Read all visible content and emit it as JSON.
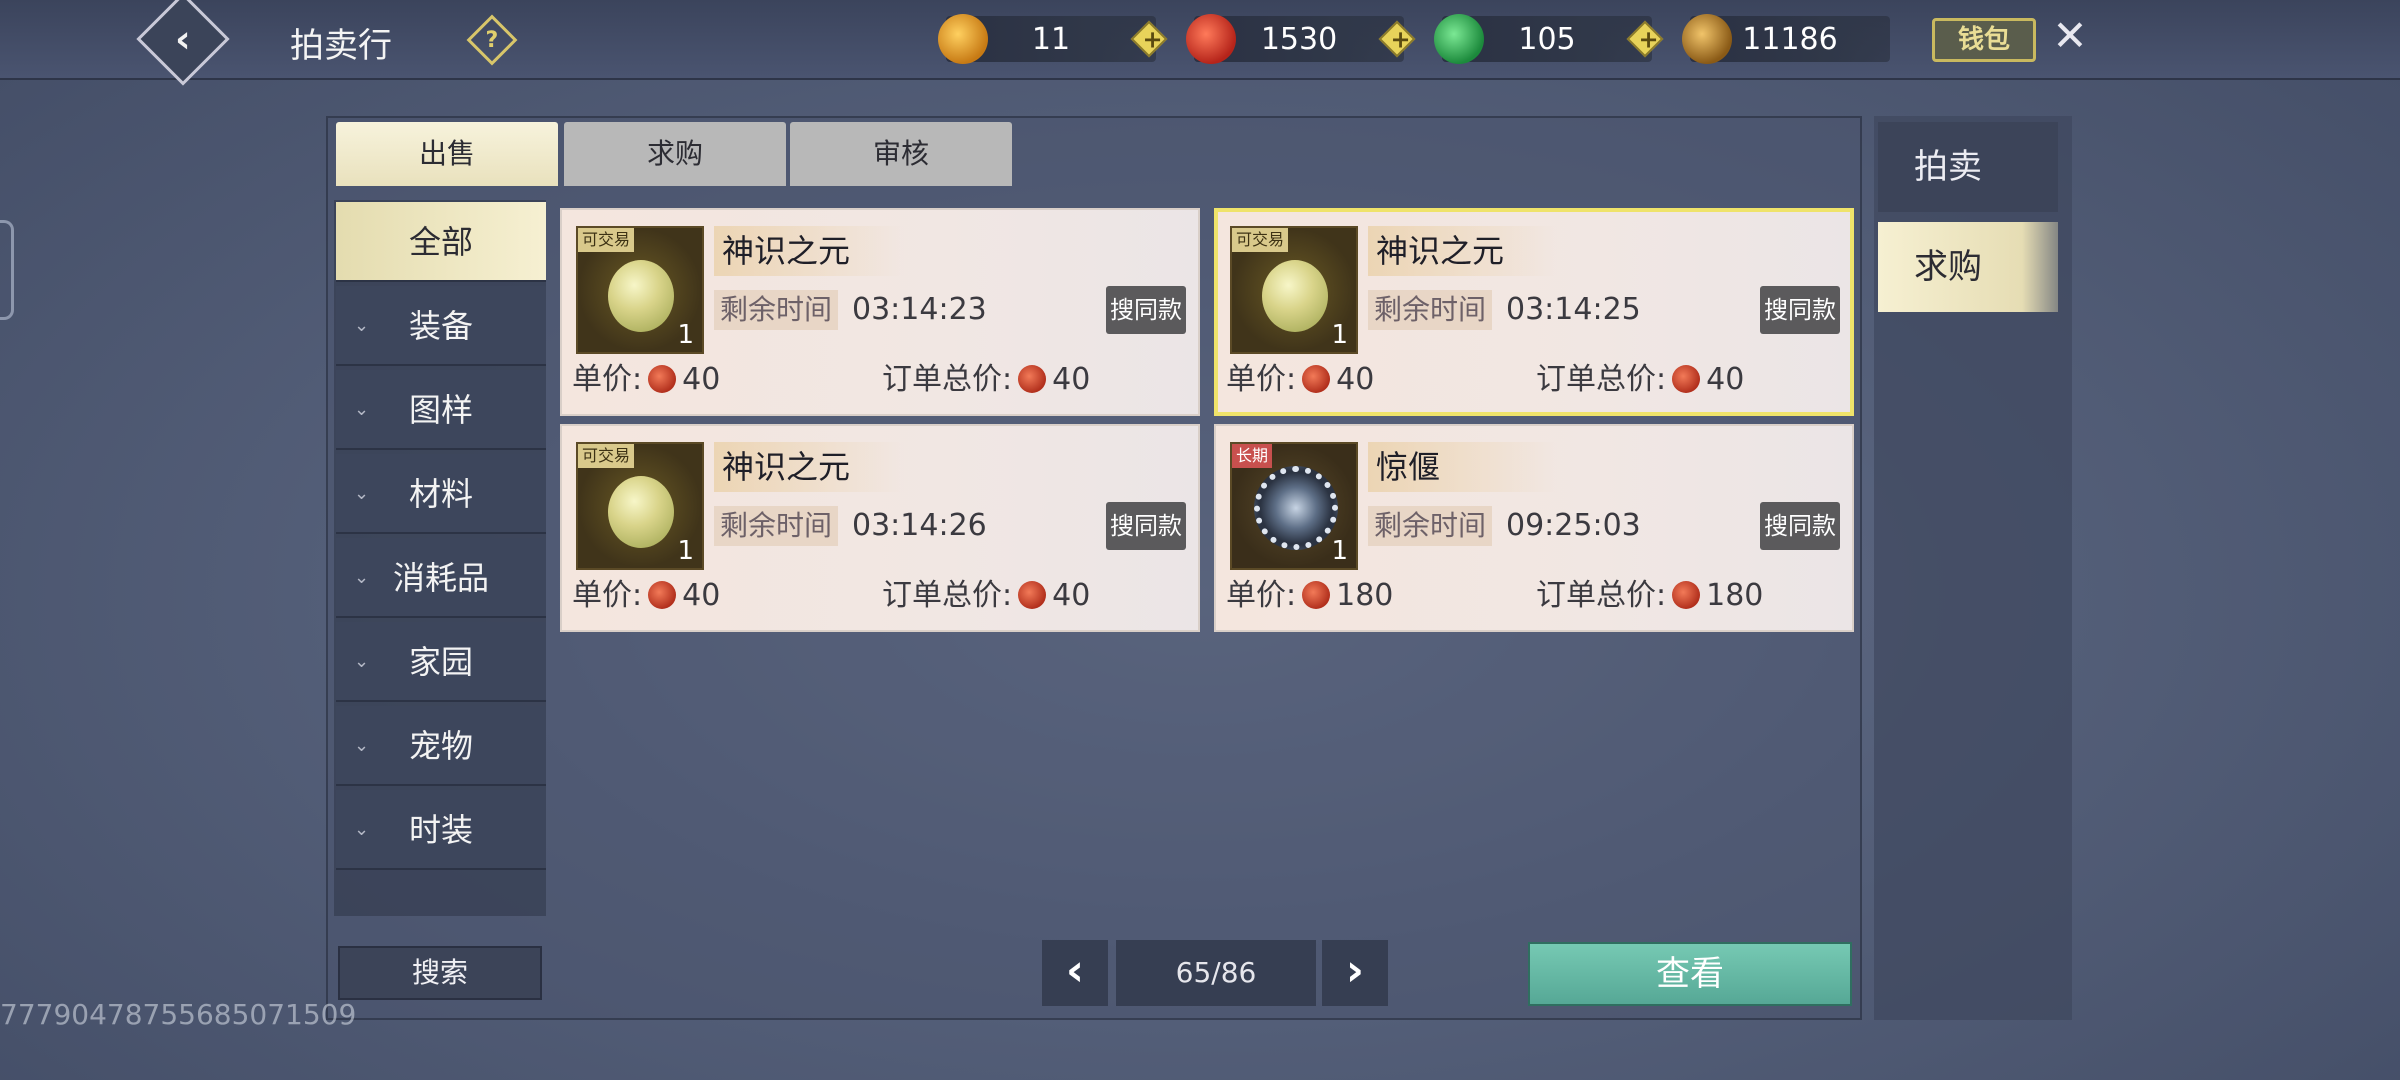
{
  "header": {
    "title": "拍卖行",
    "help_label": "?",
    "wallet_label": "钱包",
    "currencies": [
      {
        "icon": "gold-coin-icon",
        "value": "11",
        "color": "#e3a326"
      },
      {
        "icon": "red-coin-icon",
        "value": "1530",
        "color": "#e6452b"
      },
      {
        "icon": "green-jade-icon",
        "value": "105",
        "color": "#2fb55a"
      },
      {
        "icon": "copper-coin-icon",
        "value": "11186",
        "color": "#b98a2c"
      }
    ]
  },
  "tabs": [
    "出售",
    "求购",
    "审核"
  ],
  "categories": [
    "全部",
    "装备",
    "图样",
    "材料",
    "消耗品",
    "家园",
    "宠物",
    "时装"
  ],
  "side_tabs": [
    "拍卖",
    "求购"
  ],
  "listings": [
    {
      "tag": "可交易",
      "name": "神识之元",
      "qty": "1",
      "time_label": "剩余时间",
      "time": "03:14:23",
      "search_label": "搜同款",
      "unit_label": "单价:",
      "unit_price": "40",
      "total_label": "订单总价:",
      "total_price": "40"
    },
    {
      "tag": "可交易",
      "name": "神识之元",
      "qty": "1",
      "time_label": "剩余时间",
      "time": "03:14:25",
      "search_label": "搜同款",
      "unit_label": "单价:",
      "unit_price": "40",
      "total_label": "订单总价:",
      "total_price": "40"
    },
    {
      "tag": "可交易",
      "name": "神识之元",
      "qty": "1",
      "time_label": "剩余时间",
      "time": "03:14:26",
      "search_label": "搜同款",
      "unit_label": "单价:",
      "unit_price": "40",
      "total_label": "订单总价:",
      "total_price": "40"
    },
    {
      "tag": "长期",
      "name": "惊偃",
      "qty": "1",
      "time_label": "剩余时间",
      "time": "09:25:03",
      "search_label": "搜同款",
      "unit_label": "单价:",
      "unit_price": "180",
      "total_label": "订单总价:",
      "total_price": "180"
    }
  ],
  "bottom": {
    "search_label": "搜索",
    "page": "65/86",
    "view_label": "查看",
    "uid": "7779047875568507150​9"
  }
}
